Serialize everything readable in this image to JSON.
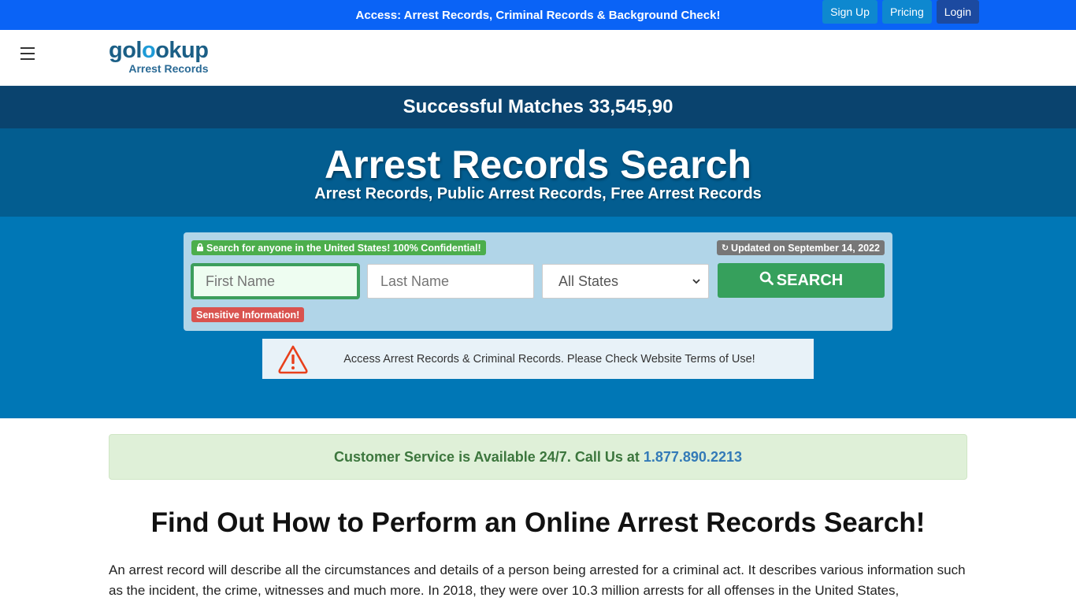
{
  "topbar": {
    "text": "Access: Arrest Records, Criminal Records & Background Check!"
  },
  "header": {
    "menu_icon": "hamburger-icon",
    "logo": {
      "main_prefix": "gol",
      "main_ring": "o",
      "main_suffix": "okup",
      "sub": "Arrest Records"
    },
    "nav": [
      {
        "label": "Sign Up"
      },
      {
        "label": "Pricing"
      },
      {
        "label": "Login"
      }
    ]
  },
  "matches": {
    "text": "Successful Matches 33,545,90"
  },
  "hero": {
    "title": "Arrest Records Search",
    "subtitle": "Arrest Records, Public Arrest Records, Free Arrest Records"
  },
  "search": {
    "confidential_badge": "Search for anyone in the United States! 100% Confidential!",
    "updated_badge": "Updated on September 14, 2022",
    "sensitive_badge": "Sensitive Information!",
    "first_name_placeholder": "First Name",
    "last_name_placeholder": "Last Name",
    "state_selected": "All States",
    "button_label": "SEARCH"
  },
  "notice": {
    "text": "Access Arrest Records & Criminal Records. Please Check Website Terms of Use!"
  },
  "service": {
    "text": "Customer Service is Available 24/7. Call Us at",
    "phone": "1.877.890.2213"
  },
  "article": {
    "title": "Find Out How to Perform an Online Arrest Records Search!",
    "body": "An arrest record will describe all the circumstances and details of a person being arrested for a criminal act. It describes various information such as the incident, the crime, witnesses and much more. In 2018, they were over 10.3 million arrests for all offenses in the United States,"
  },
  "colors": {
    "topbar": "#0a63f6",
    "matches_bar": "#0a436e",
    "hero": "#035d90",
    "search_area": "#0077b6",
    "search_button": "#36a05c",
    "login_button": "#1c4aa0"
  }
}
